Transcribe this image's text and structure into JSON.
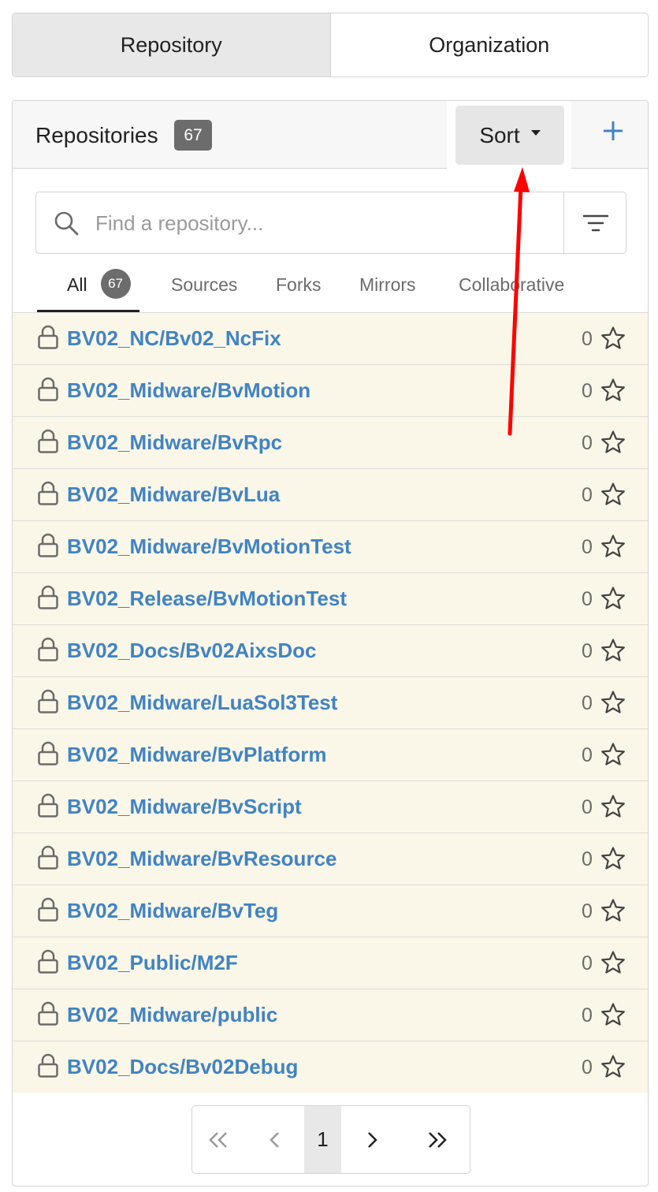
{
  "top_tabs": [
    {
      "label": "Repository",
      "active": true
    },
    {
      "label": "Organization",
      "active": false
    }
  ],
  "panel": {
    "title": "Repositories",
    "count": "67",
    "sort_label": "Sort",
    "add_icon": "plus-icon"
  },
  "search": {
    "placeholder": "Find a repository...",
    "value": ""
  },
  "filter_tabs": {
    "all": {
      "label": "All",
      "badge": "67"
    },
    "sources": {
      "label": "Sources"
    },
    "forks": {
      "label": "Forks"
    },
    "mirrors": {
      "label": "Mirrors"
    },
    "collaborative": {
      "label": "Collaborative"
    }
  },
  "repos": [
    {
      "name": "BV02_NC/Bv02_NcFix",
      "stars": "0"
    },
    {
      "name": "BV02_Midware/BvMotion",
      "stars": "0"
    },
    {
      "name": "BV02_Midware/BvRpc",
      "stars": "0"
    },
    {
      "name": "BV02_Midware/BvLua",
      "stars": "0"
    },
    {
      "name": "BV02_Midware/BvMotionTest",
      "stars": "0"
    },
    {
      "name": "BV02_Release/BvMotionTest",
      "stars": "0"
    },
    {
      "name": "BV02_Docs/Bv02AixsDoc",
      "stars": "0"
    },
    {
      "name": "BV02_Midware/LuaSol3Test",
      "stars": "0"
    },
    {
      "name": "BV02_Midware/BvPlatform",
      "stars": "0"
    },
    {
      "name": "BV02_Midware/BvScript",
      "stars": "0"
    },
    {
      "name": "BV02_Midware/BvResource",
      "stars": "0"
    },
    {
      "name": "BV02_Midware/BvTeg",
      "stars": "0"
    },
    {
      "name": "BV02_Public/M2F",
      "stars": "0"
    },
    {
      "name": "BV02_Midware/public",
      "stars": "0"
    },
    {
      "name": "BV02_Docs/Bv02Debug",
      "stars": "0"
    }
  ],
  "pagination": {
    "current_page": "1"
  },
  "colors": {
    "link": "#4183c4",
    "row_bg": "#faf7e8",
    "badge_bg": "#6c6c6c",
    "annotation_arrow": "#ff0000"
  }
}
